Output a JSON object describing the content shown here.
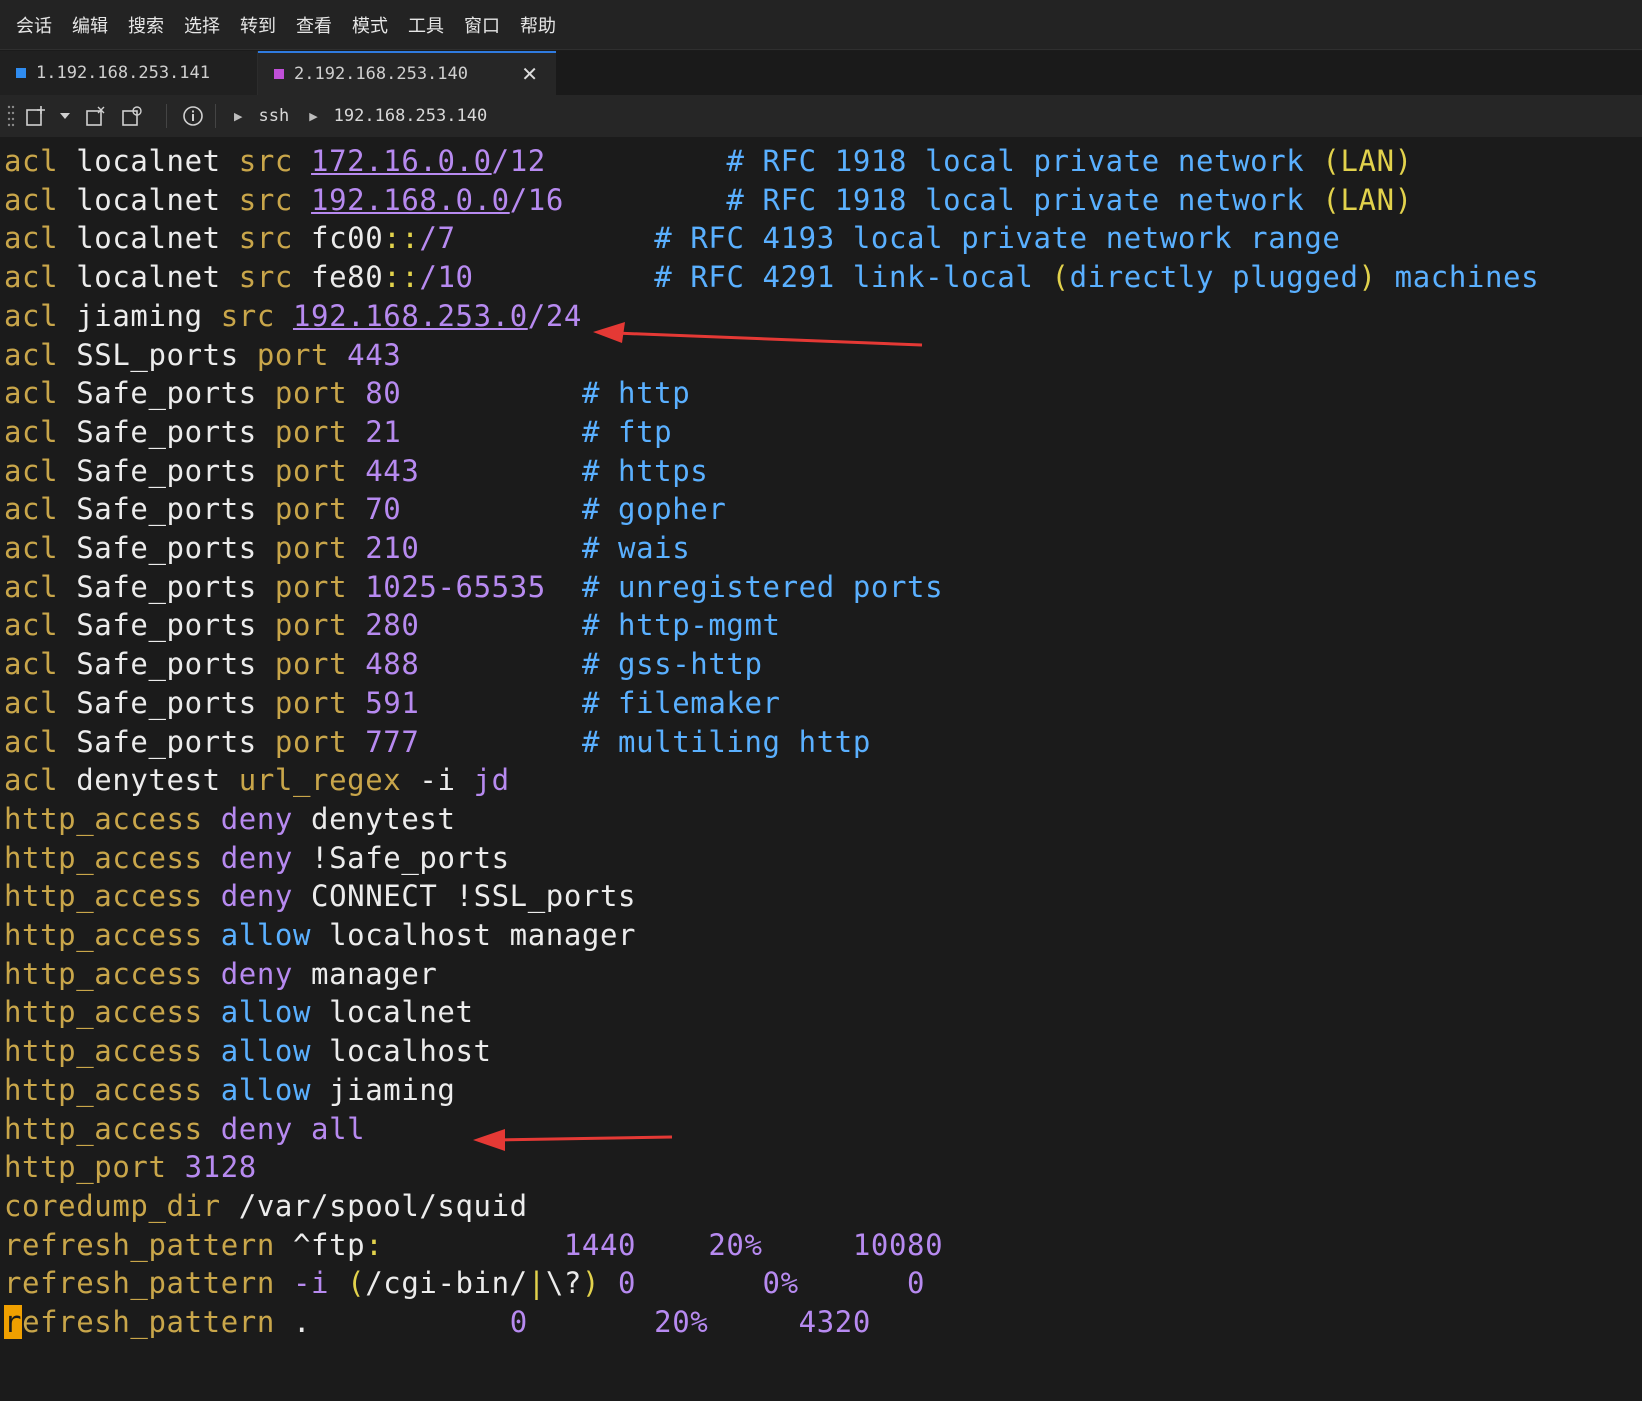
{
  "menu": [
    "会话",
    "编辑",
    "搜索",
    "选择",
    "转到",
    "查看",
    "模式",
    "工具",
    "窗口",
    "帮助"
  ],
  "tabs": [
    {
      "label": "1.192.168.253.141",
      "color": "#2f8cf0",
      "active": false
    },
    {
      "label": "2.192.168.253.140",
      "color": "#c04fd8",
      "active": true,
      "close": "✕"
    }
  ],
  "toolbar": {
    "breadcrumb": [
      "ssh",
      "192.168.253.140"
    ]
  },
  "colors": {
    "keyword": "#c9a64a",
    "text": "#ececec",
    "value": "#b78af0",
    "comment": "#5ab0ff",
    "annotation_arrow": "#e53935"
  },
  "terminal_lines": [
    [
      [
        "acl ",
        "kw"
      ],
      [
        "localnet ",
        "wh"
      ],
      [
        "src ",
        "kw"
      ],
      [
        "172.16.0.0",
        "pu ul"
      ],
      [
        "/12          ",
        "pu"
      ],
      [
        "# RFC 1918 local private network ",
        "cm"
      ],
      [
        "(LAN)",
        "ye"
      ]
    ],
    [
      [
        "acl ",
        "kw"
      ],
      [
        "localnet ",
        "wh"
      ],
      [
        "src ",
        "kw"
      ],
      [
        "192.168.0.0",
        "pu ul"
      ],
      [
        "/16         ",
        "pu"
      ],
      [
        "# RFC 1918 local private network ",
        "cm"
      ],
      [
        "(LAN)",
        "ye"
      ]
    ],
    [
      [
        "acl ",
        "kw"
      ],
      [
        "localnet ",
        "wh"
      ],
      [
        "src ",
        "kw"
      ],
      [
        "fc00",
        "wh"
      ],
      [
        "::",
        "ye"
      ],
      [
        "/7           ",
        "pu"
      ],
      [
        "# RFC 4193 local private network range",
        "cm"
      ]
    ],
    [
      [
        "acl ",
        "kw"
      ],
      [
        "localnet ",
        "wh"
      ],
      [
        "src ",
        "kw"
      ],
      [
        "fe80",
        "wh"
      ],
      [
        "::",
        "ye"
      ],
      [
        "/10          ",
        "pu"
      ],
      [
        "# RFC 4291 link-local ",
        "cm"
      ],
      [
        "(",
        "ye"
      ],
      [
        "directly plugged",
        "cm"
      ],
      [
        ")",
        "ye"
      ],
      [
        " machines",
        "cm"
      ]
    ],
    [
      [
        "acl ",
        "kw"
      ],
      [
        "jiaming ",
        "wh"
      ],
      [
        "src ",
        "kw"
      ],
      [
        "192.168.253.0",
        "pu ul"
      ],
      [
        "/24",
        "pu"
      ]
    ],
    [
      [
        "acl ",
        "kw"
      ],
      [
        "SSL_ports ",
        "wh"
      ],
      [
        "port ",
        "kw"
      ],
      [
        "443",
        "pu"
      ]
    ],
    [
      [
        "acl ",
        "kw"
      ],
      [
        "Safe_ports ",
        "wh"
      ],
      [
        "port ",
        "kw"
      ],
      [
        "80          ",
        "pu"
      ],
      [
        "# http",
        "cm"
      ]
    ],
    [
      [
        "acl ",
        "kw"
      ],
      [
        "Safe_ports ",
        "wh"
      ],
      [
        "port ",
        "kw"
      ],
      [
        "21          ",
        "pu"
      ],
      [
        "# ftp",
        "cm"
      ]
    ],
    [
      [
        "acl ",
        "kw"
      ],
      [
        "Safe_ports ",
        "wh"
      ],
      [
        "port ",
        "kw"
      ],
      [
        "443         ",
        "pu"
      ],
      [
        "# https",
        "cm"
      ]
    ],
    [
      [
        "acl ",
        "kw"
      ],
      [
        "Safe_ports ",
        "wh"
      ],
      [
        "port ",
        "kw"
      ],
      [
        "70          ",
        "pu"
      ],
      [
        "# gopher",
        "cm"
      ]
    ],
    [
      [
        "acl ",
        "kw"
      ],
      [
        "Safe_ports ",
        "wh"
      ],
      [
        "port ",
        "kw"
      ],
      [
        "210         ",
        "pu"
      ],
      [
        "# wais",
        "cm"
      ]
    ],
    [
      [
        "acl ",
        "kw"
      ],
      [
        "Safe_ports ",
        "wh"
      ],
      [
        "port ",
        "kw"
      ],
      [
        "1025-65535  ",
        "pu"
      ],
      [
        "# unregistered ports",
        "cm"
      ]
    ],
    [
      [
        "acl ",
        "kw"
      ],
      [
        "Safe_ports ",
        "wh"
      ],
      [
        "port ",
        "kw"
      ],
      [
        "280         ",
        "pu"
      ],
      [
        "# http-mgmt",
        "cm"
      ]
    ],
    [
      [
        "acl ",
        "kw"
      ],
      [
        "Safe_ports ",
        "wh"
      ],
      [
        "port ",
        "kw"
      ],
      [
        "488         ",
        "pu"
      ],
      [
        "# gss-http",
        "cm"
      ]
    ],
    [
      [
        "acl ",
        "kw"
      ],
      [
        "Safe_ports ",
        "wh"
      ],
      [
        "port ",
        "kw"
      ],
      [
        "591         ",
        "pu"
      ],
      [
        "# filemaker",
        "cm"
      ]
    ],
    [
      [
        "acl ",
        "kw"
      ],
      [
        "Safe_ports ",
        "wh"
      ],
      [
        "port ",
        "kw"
      ],
      [
        "777         ",
        "pu"
      ],
      [
        "# multiling http",
        "cm"
      ]
    ],
    [
      [
        "acl ",
        "kw"
      ],
      [
        "denytest ",
        "wh"
      ],
      [
        "url_regex ",
        "kw"
      ],
      [
        "-i ",
        "wh"
      ],
      [
        "jd",
        "pu"
      ]
    ],
    [
      [
        "http_access ",
        "kw"
      ],
      [
        "deny ",
        "pu"
      ],
      [
        "denytest",
        "wh"
      ]
    ],
    [
      [
        "http_access ",
        "kw"
      ],
      [
        "deny ",
        "pu"
      ],
      [
        "!Safe_ports",
        "wh"
      ]
    ],
    [
      [
        "http_access ",
        "kw"
      ],
      [
        "deny ",
        "pu"
      ],
      [
        "CONNECT !SSL_ports",
        "wh"
      ]
    ],
    [
      [
        "http_access ",
        "kw"
      ],
      [
        "allow ",
        "cm"
      ],
      [
        "localhost manager",
        "wh"
      ]
    ],
    [
      [
        "http_access ",
        "kw"
      ],
      [
        "deny ",
        "pu"
      ],
      [
        "manager",
        "wh"
      ]
    ],
    [
      [
        "http_access ",
        "kw"
      ],
      [
        "allow ",
        "cm"
      ],
      [
        "localnet",
        "wh"
      ]
    ],
    [
      [
        "http_access ",
        "kw"
      ],
      [
        "allow ",
        "cm"
      ],
      [
        "localhost",
        "wh"
      ]
    ],
    [
      [
        "http_access ",
        "kw"
      ],
      [
        "allow ",
        "cm"
      ],
      [
        "jiaming",
        "wh"
      ]
    ],
    [
      [
        "http_access ",
        "kw"
      ],
      [
        "deny ",
        "pu"
      ],
      [
        "all",
        "pu"
      ]
    ],
    [
      [
        "http_port ",
        "kw"
      ],
      [
        "3128",
        "pu"
      ]
    ],
    [
      [
        "coredump_dir ",
        "kw"
      ],
      [
        "/var/spool/squid",
        "wh"
      ]
    ],
    [
      [
        "refresh_pattern ",
        "kw"
      ],
      [
        "^ftp",
        "wh"
      ],
      [
        ":",
        "ye"
      ],
      [
        "          ",
        "wh"
      ],
      [
        "1440    ",
        "pu"
      ],
      [
        "20%     ",
        "pu"
      ],
      [
        "10080",
        "pu"
      ]
    ],
    [
      [
        "refresh_pattern ",
        "kw"
      ],
      [
        "-i ",
        "pu"
      ],
      [
        "(",
        "ye"
      ],
      [
        "/cgi-bin/",
        "wh"
      ],
      [
        "|",
        "ye"
      ],
      [
        "\\?",
        "wh"
      ],
      [
        ")",
        "ye"
      ],
      [
        " 0       ",
        "pu"
      ],
      [
        "0%      ",
        "pu"
      ],
      [
        "0",
        "pu"
      ]
    ],
    [
      [
        "r",
        "cursor"
      ],
      [
        "efresh_pattern ",
        "kw"
      ],
      [
        ".           ",
        "wh"
      ],
      [
        "0       ",
        "pu"
      ],
      [
        "20%     ",
        "pu"
      ],
      [
        "4320",
        "pu"
      ]
    ]
  ]
}
